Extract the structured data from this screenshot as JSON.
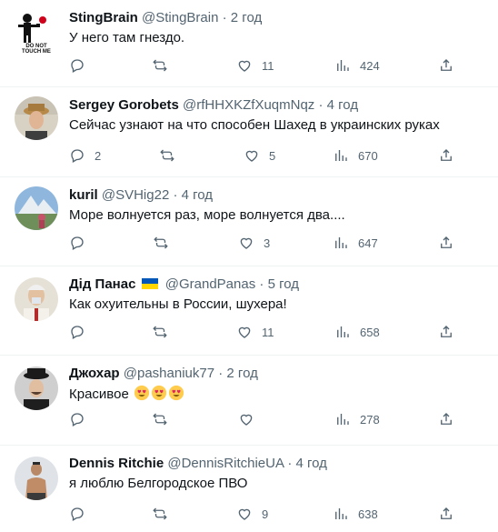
{
  "tweets": [
    {
      "name": "StingBrain",
      "handle": "@StingBrain",
      "time": "2 год",
      "text": "У него там гнездо.",
      "avatar_text": "DO NOT TOUCH ME",
      "replies": "",
      "likes": "11",
      "views": "424"
    },
    {
      "name": "Sergey Gorobets",
      "handle": "@rfHHXKZfXuqmNqz",
      "time": "4 год",
      "text": "Сейчас узнают на что способен Шахед в украинских руках",
      "replies": "2",
      "likes": "5",
      "views": "670"
    },
    {
      "name": "kuril",
      "handle": "@SVHig22",
      "time": "4 год",
      "text": "Море волнуется раз, море волнуется два....",
      "replies": "",
      "likes": "3",
      "views": "647"
    },
    {
      "name": "Дід Панас",
      "handle": "@GrandPanas",
      "time": "5 год",
      "text": "Как охуительны в России, шухера!",
      "replies": "",
      "likes": "11",
      "views": "658"
    },
    {
      "name": "Джохар",
      "handle": "@pashaniuk77",
      "time": "2 год",
      "text": "Красивое",
      "replies": "",
      "likes": "",
      "views": "278"
    },
    {
      "name": "Dennis Ritchie",
      "handle": "@DennisRitchieUA",
      "time": "4 год",
      "text": "я люблю Белгородское ПВО",
      "replies": "",
      "likes": "9",
      "views": "638"
    }
  ],
  "icons": {
    "reply": "reply-icon",
    "retweet": "retweet-icon",
    "like": "heart-icon",
    "views": "views-icon",
    "share": "share-icon",
    "flag": "ukraine-flag-icon",
    "emoji": "heart-eyes-emoji-icon"
  },
  "colors": {
    "secondary_text": "#536471",
    "divider": "#eff3f4",
    "flag_blue": "#0057b7",
    "flag_yellow": "#ffd700"
  }
}
